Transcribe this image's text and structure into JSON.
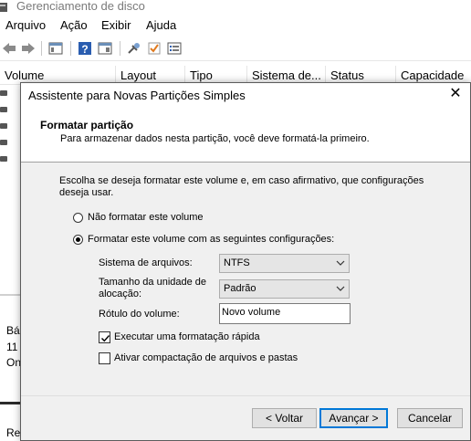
{
  "background": {
    "window_title": "Gerenciamento de disco",
    "menu": [
      "Arquivo",
      "Ação",
      "Exibir",
      "Ajuda"
    ],
    "columns": [
      "Volume",
      "Layout",
      "Tipo",
      "Sistema de...",
      "Status",
      "Capacidade"
    ],
    "side_texts": [
      "Bá",
      "11",
      "On",
      "Re"
    ]
  },
  "dialog": {
    "title": "Assistente para Novas Partições Simples",
    "heading": "Formatar partição",
    "subheading": "Para armazenar dados nesta partição, você deve formatá-la primeiro.",
    "intro": "Escolha se deseja formatar este volume e, em caso afirmativo, que configurações deseja usar.",
    "radio_no_format": "Não formatar este volume",
    "radio_format": "Formatar este volume com as seguintes configurações:",
    "selected_option": "format",
    "filesystem_label": "Sistema de arquivos:",
    "filesystem_value": "NTFS",
    "alloc_label": "Tamanho da unidade de alocação:",
    "alloc_value": "Padrão",
    "volume_label_label": "Rótulo do volume:",
    "volume_label_value": "Novo volume",
    "quick_format_label": "Executar uma formatação rápida",
    "quick_format_checked": true,
    "compression_label": "Ativar compactação de arquivos e pastas",
    "compression_checked": false,
    "buttons": {
      "back": "< Voltar",
      "next": "Avançar >",
      "cancel": "Cancelar"
    },
    "accent_color": "#0078d7"
  }
}
